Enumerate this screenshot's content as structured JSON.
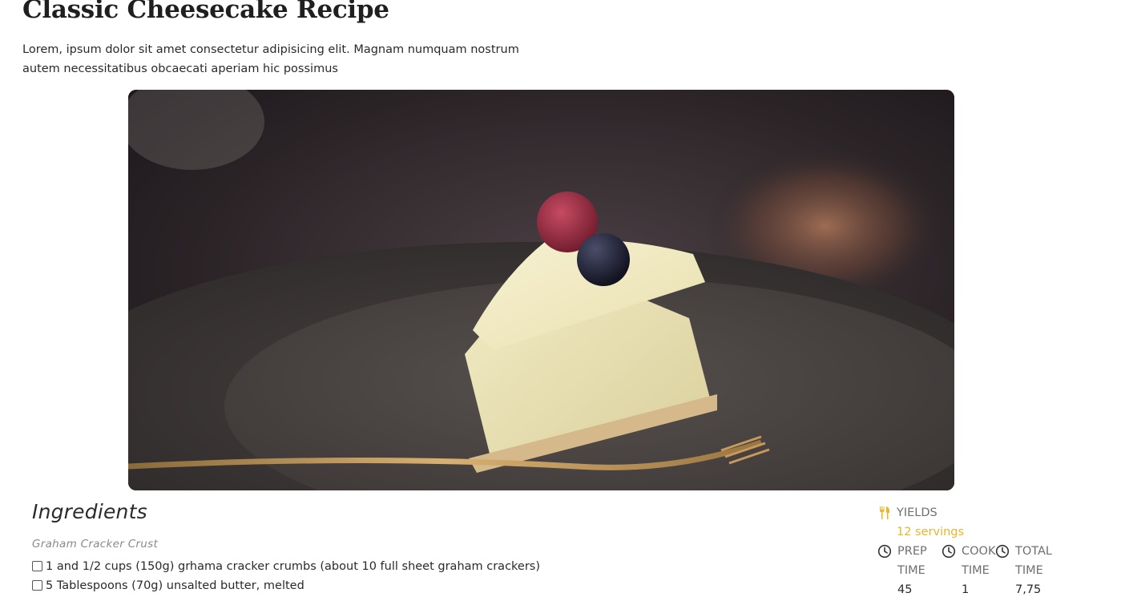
{
  "recipe": {
    "title": "Classic Cheesecake Recipe",
    "intro": "Lorem, ipsum dolor sit amet consectetur adipisicing elit. Magnam numquam nostrum autem necessitatibus obcaecati aperiam hic possimus"
  },
  "hero": {
    "subject": "slice of cheesecake on a dark plate with a raspberry, a blueberry and a gold fork"
  },
  "ingredients": {
    "heading": "Ingredients",
    "group_label": "Graham Cracker Crust",
    "items": [
      {
        "text": "1 and 1/2 cups (150g) grhama cracker crumbs (about 10 full sheet graham crackers)",
        "checked": false
      },
      {
        "text": "5 Tablespoons (70g) unsalted butter, melted",
        "checked": false
      }
    ]
  },
  "meta": {
    "yields_label": "YIELDS",
    "yields_value": "12 servings",
    "prep": {
      "label_1": "PREP",
      "label_2": "TIME",
      "value": "45"
    },
    "cook": {
      "label_1": "COOK",
      "label_2": "TIME",
      "value": "1"
    },
    "total": {
      "label_1": "TOTAL",
      "label_2": "TIME",
      "value": "7,75"
    },
    "icons": {
      "yields": "utensils-icon",
      "time": "clock-icon"
    }
  },
  "colors": {
    "accent": "#e8b62a",
    "meta_text": "#6f6f6f",
    "title": "#1f1f1f"
  }
}
